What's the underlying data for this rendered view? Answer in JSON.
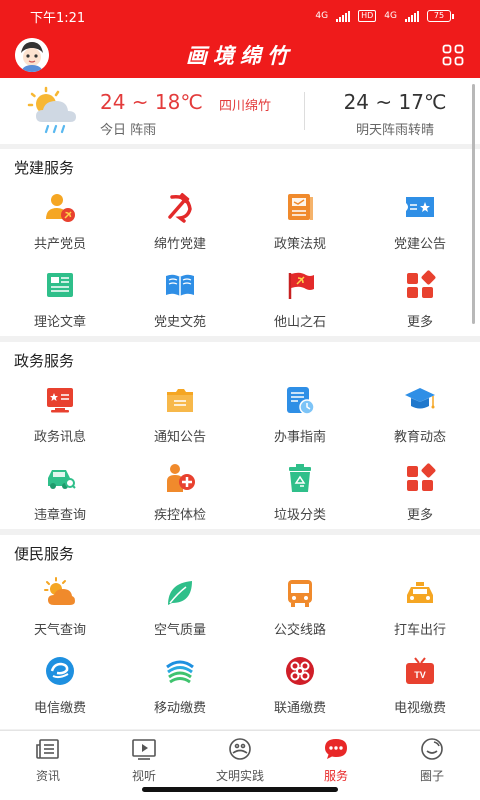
{
  "status": {
    "time": "下午1:21",
    "net1": "4G",
    "hd": "HD",
    "net2": "4G",
    "battery": "75"
  },
  "header": {
    "title": "画境绵竹"
  },
  "weather": {
    "today_temp": "24 ~ 18℃",
    "location": "四川绵竹",
    "today_desc": "今日 阵雨",
    "tomorrow_temp": "24 ~ 17℃",
    "tomorrow_desc": "明天阵雨转晴"
  },
  "party": {
    "title": "党建服务",
    "items": [
      {
        "label": "共产党员",
        "icon": "party-member-icon"
      },
      {
        "label": "绵竹党建",
        "icon": "hammer-sickle-icon"
      },
      {
        "label": "政策法规",
        "icon": "policy-book-icon"
      },
      {
        "label": "党建公告",
        "icon": "notice-card-icon"
      },
      {
        "label": "理论文章",
        "icon": "article-icon"
      },
      {
        "label": "党史文苑",
        "icon": "open-book-icon"
      },
      {
        "label": "他山之石",
        "icon": "party-flag-icon"
      },
      {
        "label": "更多",
        "icon": "more-icon"
      }
    ]
  },
  "gov": {
    "title": "政务服务",
    "items": [
      {
        "label": "政务讯息",
        "icon": "gov-news-icon"
      },
      {
        "label": "通知公告",
        "icon": "folder-notice-icon"
      },
      {
        "label": "办事指南",
        "icon": "guide-doc-icon"
      },
      {
        "label": "教育动态",
        "icon": "graduation-cap-icon"
      },
      {
        "label": "违章查询",
        "icon": "car-search-icon"
      },
      {
        "label": "疾控体检",
        "icon": "health-check-icon"
      },
      {
        "label": "垃圾分类",
        "icon": "recycle-bin-icon"
      },
      {
        "label": "更多",
        "icon": "more-icon"
      }
    ]
  },
  "people": {
    "title": "便民服务",
    "items": [
      {
        "label": "天气查询",
        "icon": "weather-icon"
      },
      {
        "label": "空气质量",
        "icon": "leaf-icon"
      },
      {
        "label": "公交线路",
        "icon": "bus-icon"
      },
      {
        "label": "打车出行",
        "icon": "taxi-icon"
      },
      {
        "label": "电信缴费",
        "icon": "telecom-icon"
      },
      {
        "label": "移动缴费",
        "icon": "mobile-icon"
      },
      {
        "label": "联通缴费",
        "icon": "unicom-icon"
      },
      {
        "label": "电视缴费",
        "icon": "tv-icon"
      }
    ]
  },
  "nav": [
    {
      "label": "资讯",
      "icon": "news-icon"
    },
    {
      "label": "视听",
      "icon": "video-icon"
    },
    {
      "label": "文明实践",
      "icon": "civilization-icon"
    },
    {
      "label": "服务",
      "icon": "service-icon",
      "active": true
    },
    {
      "label": "圈子",
      "icon": "circle-icon"
    }
  ],
  "colors": {
    "brand": "#ef1b1b",
    "accent": "#e82828"
  }
}
